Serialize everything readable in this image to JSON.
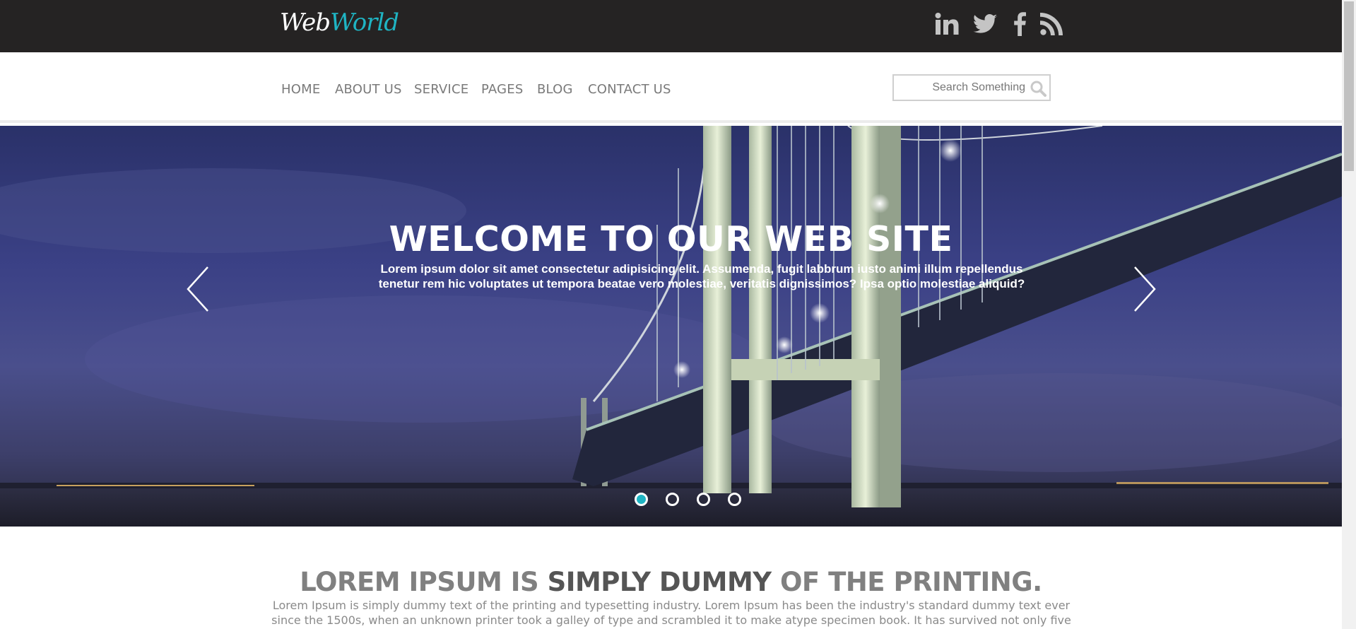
{
  "logo": {
    "part1": "Web",
    "part2": "World"
  },
  "social": [
    "linkedin-icon",
    "twitter-icon",
    "facebook-icon",
    "rss-icon"
  ],
  "nav": {
    "items": [
      "HOME",
      "ABOUT US",
      "SERVICE",
      "PAGES",
      "BLOG",
      "CONTACT US"
    ]
  },
  "search": {
    "placeholder": "Search Something"
  },
  "hero": {
    "title": "WELCOME TO OUR WEB SITE",
    "text": "Lorem ipsum dolor sit amet consectetur adipisicing elit. Assumenda, fugit labbrum iusto animi illum repellendus tenetur rem hic voluptates ut tempora beatae vero molestiae, veritatis dignissimos? Ipsa optio molestiae aliquid?",
    "slides": 4,
    "active_slide": 1
  },
  "intro": {
    "heading_part1": "LOREM IPSUM IS ",
    "heading_part2": "SIMPLY DUMMY",
    "heading_part3": " OF THE PRINTING.",
    "text": "Lorem Ipsum is simply dummy text of the printing and typesetting industry. Lorem Ipsum has been the industry's standard dummy text ever since the 1500s, when an unknown printer took a galley of type and scrambled it to make atype specimen book. It has survived not only five centuries."
  },
  "colors": {
    "accent": "#1fb4c3",
    "topbar": "#252323",
    "nav_text": "#7a7a7a"
  }
}
